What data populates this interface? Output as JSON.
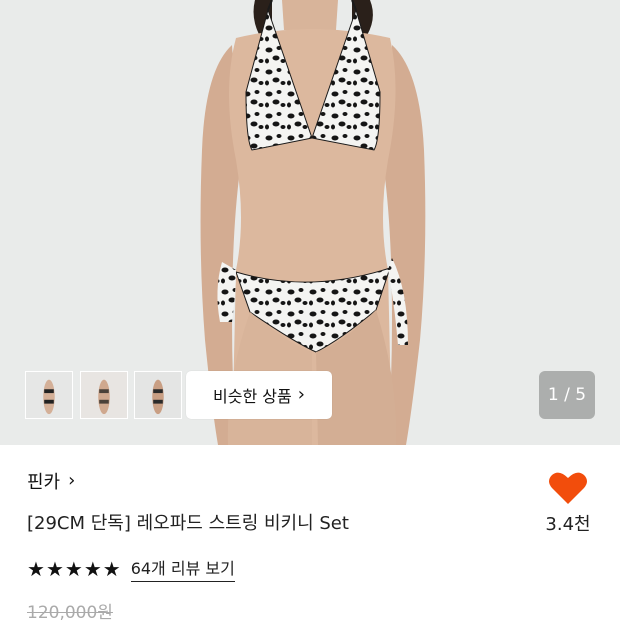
{
  "colors": {
    "heart": "#f24d0c",
    "hero_bg": "#e9ebea",
    "text": "#111111",
    "price_strike": "#aaaaaa"
  },
  "thumbnails": [
    {
      "name": "thumbnail-1"
    },
    {
      "name": "thumbnail-2"
    },
    {
      "name": "thumbnail-3"
    }
  ],
  "similar_button": {
    "label": "비슷한 상품",
    "icon": "chevron-right-icon"
  },
  "pager": {
    "text": "1 / 5"
  },
  "brand": {
    "label": "핀카",
    "icon": "chevron-right-icon"
  },
  "product": {
    "title": "[29CM 단독] 레오파드 스트링 비키니 Set",
    "rating_stars": 5,
    "review_link": "64개 리뷰 보기",
    "original_price": "120,000원"
  },
  "like": {
    "icon": "heart-icon",
    "count": "3.4천"
  }
}
